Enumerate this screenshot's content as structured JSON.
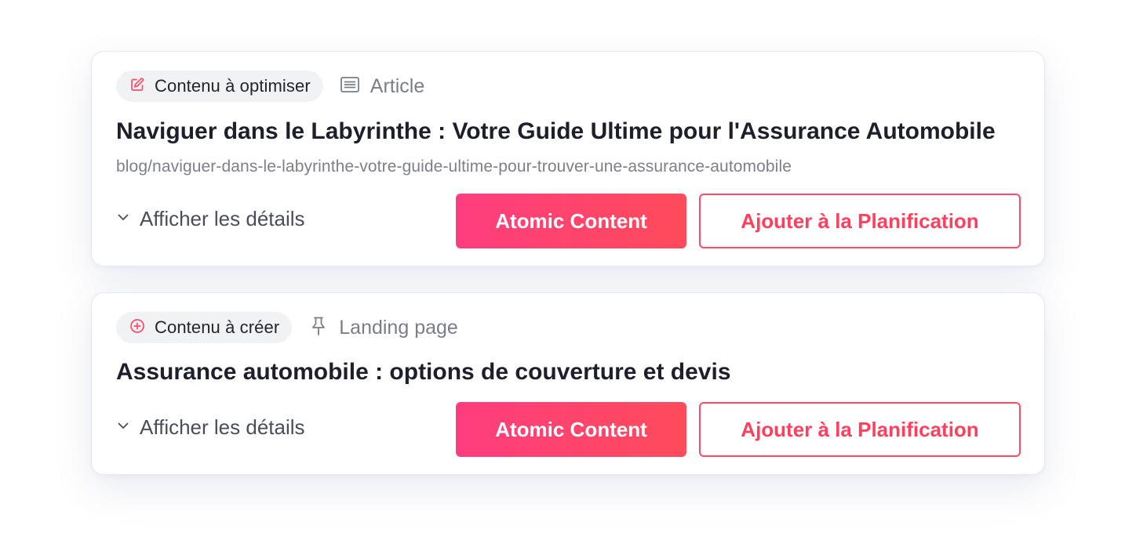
{
  "colors": {
    "accent": "#ff4b68",
    "accent_gradient_start": "#ff3d7f",
    "accent_gradient_end": "#ff4b5a",
    "chip_background": "#f1f2f4",
    "title_text": "#1d1f2b",
    "muted_text": "#7a7e88"
  },
  "cards": [
    {
      "status": {
        "icon": "edit-icon",
        "label": "Contenu à optimiser"
      },
      "type": {
        "icon": "article-icon",
        "label": "Article"
      },
      "title": "Naviguer dans le Labyrinthe : Votre Guide Ultime pour l'Assurance Automobile",
      "url": "blog/naviguer-dans-le-labyrinthe-votre-guide-ultime-pour-trouver-une-assurance-automobile",
      "details_label": "Afficher les détails",
      "details_icon": "chevron-down-icon",
      "atomic_label": "Atomic Content",
      "schedule_label": "Ajouter à la Planification"
    },
    {
      "status": {
        "icon": "plus-circle-icon",
        "label": "Contenu à créer"
      },
      "type": {
        "icon": "pin-icon",
        "label": "Landing page"
      },
      "title": "Assurance automobile : options de couverture et devis",
      "details_label": "Afficher les détails",
      "details_icon": "chevron-down-icon",
      "atomic_label": "Atomic Content",
      "schedule_label": "Ajouter à la Planification"
    }
  ]
}
